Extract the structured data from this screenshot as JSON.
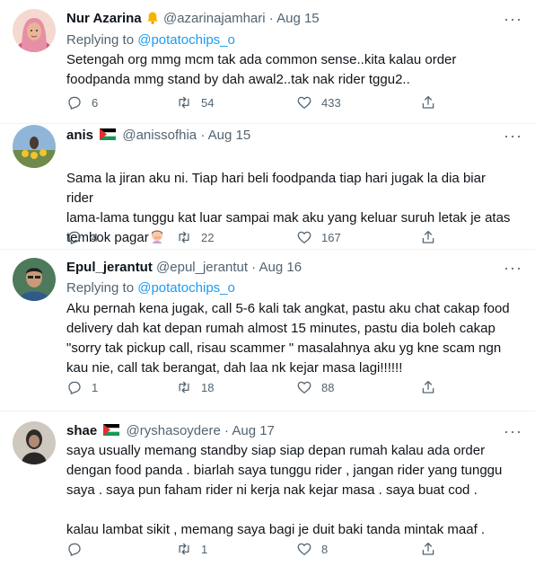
{
  "tweets": [
    {
      "name": "Nur Azarina",
      "handle": "@azarinajamhari",
      "date": "Aug 15",
      "replying_label": "Replying to",
      "replying_handle": "@potatochips_o",
      "text": "Setengah org mmg mcm tak ada common sense..kita kalau order\nfoodpanda mmg stand by dah awal2..tak nak rider tggu2..",
      "replies": "6",
      "retweets": "54",
      "likes": "433",
      "badge_icon": "bell-emoji-icon"
    },
    {
      "name": "anis",
      "handle": "@anissofhia",
      "date": "Aug 15",
      "text": "Sama la jiran aku ni. Tiap hari beli foodpanda tiap hari jugak la dia biar rider\nlama-lama tunggu kat luar sampai mak aku yang keluar suruh letak je atas\ntembok pagar",
      "replies": "4",
      "retweets": "22",
      "likes": "167",
      "badge_icon": "palestine-flag-icon"
    },
    {
      "name": "Epul_jerantut",
      "handle": "@epul_jerantut",
      "date": "Aug 16",
      "replying_label": "Replying to",
      "replying_handle": "@potatochips_o",
      "text": "Aku pernah kena jugak, call 5-6 kali tak angkat, pastu aku chat cakap food\ndelivery dah kat depan rumah almost 15 minutes, pastu dia boleh cakap\n\"sorry tak pickup call, risau scammer \" masalahnya aku yg kne scam ngn\nkau nie, call tak berangat, dah laa nk kejar masa lagi!!!!!!",
      "replies": "1",
      "retweets": "18",
      "likes": "88"
    },
    {
      "name": "shae",
      "handle": "@ryshasoydere",
      "date": "Aug 17",
      "text": "saya usually memang standby siap siap depan rumah kalau ada order\ndengan food panda . biarlah saya tunggu rider , jangan rider yang tunggu\nsaya . saya pun faham rider ni kerja nak kejar masa . saya buat cod .\n\nkalau lambat sikit , memang saya bagi je duit baki tanda mintak maaf .",
      "replies": "",
      "retweets": "1",
      "likes": "8",
      "badge_icon": "palestine-flag-icon"
    }
  ],
  "separator": "·",
  "more_icon": "more-options-icon",
  "colors": {
    "link": "#1d9bf0",
    "muted": "#536471",
    "text": "#0f1419",
    "divider": "#eff3f4"
  }
}
